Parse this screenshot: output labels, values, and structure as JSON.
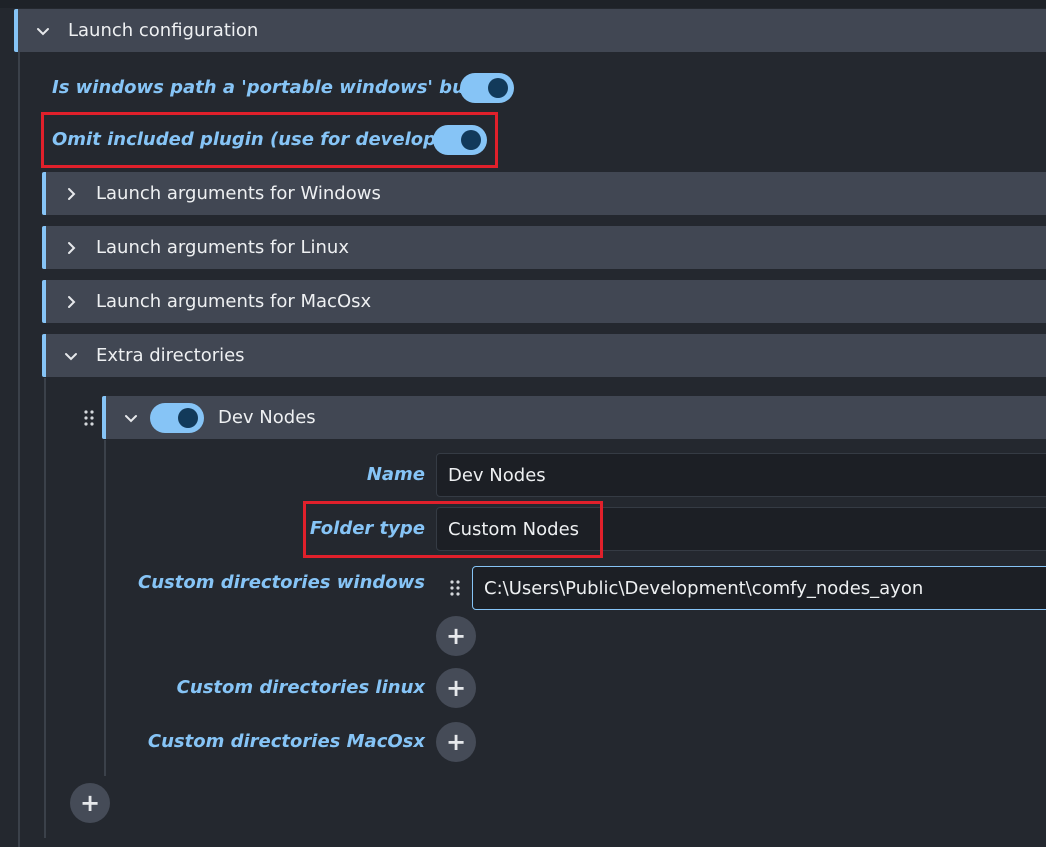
{
  "launch_config": {
    "title": "Launch configuration"
  },
  "portable_toggle": {
    "label": "Is windows path a 'portable windows' build?",
    "on": true
  },
  "omit_plugin_toggle": {
    "label": "Omit included plugin (use for developing)",
    "on": true
  },
  "sections": {
    "windows": "Launch arguments for Windows",
    "linux": "Launch arguments for Linux",
    "macos": "Launch arguments for MacOsx",
    "extra": "Extra directories"
  },
  "dev_nodes": {
    "title": "Dev Nodes",
    "enabled": true,
    "name_label": "Name",
    "name_value": "Dev Nodes",
    "folder_type_label": "Folder type",
    "folder_type_value": "Custom Nodes",
    "custom_windows_label": "Custom directories windows",
    "custom_windows_paths": [
      "C:\\Users\\Public\\Development\\comfy_nodes_ayon"
    ],
    "custom_linux_label": "Custom directories linux",
    "custom_macos_label": "Custom directories MacOsx"
  },
  "colors": {
    "accent": "#86c4f6",
    "highlight": "#e0202b",
    "panel": "#414753",
    "background": "#24282f"
  },
  "icons": {
    "expanded": "chevron-down-icon",
    "collapsed": "chevron-right-icon",
    "add": "plus-icon",
    "drag": "drag-handle-icon"
  }
}
